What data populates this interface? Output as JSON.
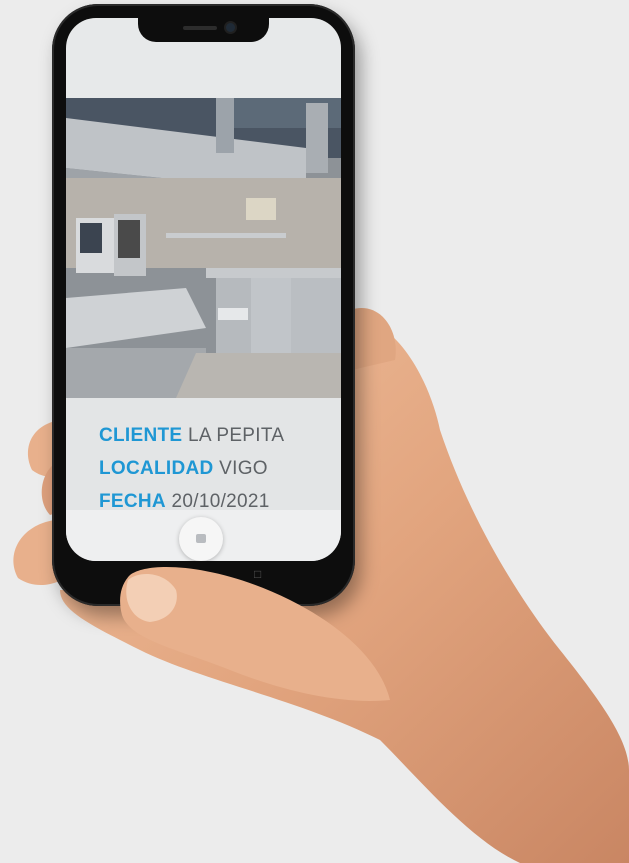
{
  "card": {
    "cliente_label": "CLIENTE",
    "cliente_value": "LA PEPITA",
    "localidad_label": "LOCALIDAD",
    "localidad_value": "VIGO",
    "fecha_label": "FECHA",
    "fecha_value": "20/10/2021"
  },
  "colors": {
    "label_blue": "#1f97d4",
    "value_gray": "#5e6266",
    "background": "#ececec"
  },
  "icons": [
    "home-button-icon",
    "back-nav-icon",
    "home-nav-icon",
    "recent-apps-icon"
  ]
}
